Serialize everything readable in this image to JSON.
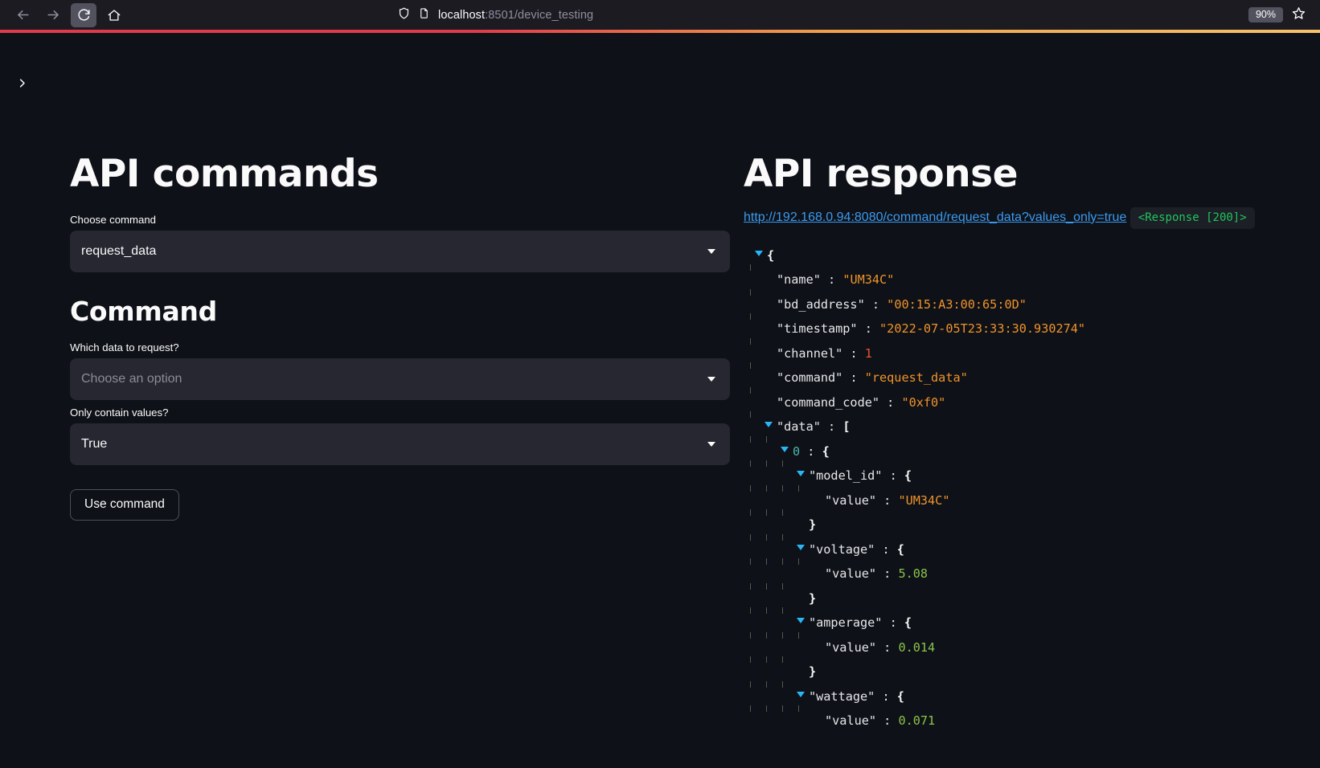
{
  "browser": {
    "back_icon": "arrow-left-icon",
    "forward_icon": "arrow-right-icon",
    "reload_icon": "reload-icon",
    "home_icon": "home-icon",
    "shield_icon": "shield-icon",
    "page_icon": "page-icon",
    "url_prefix": "localhost",
    "url_suffix": ":8501/device_testing",
    "zoom_level": "90%",
    "bookmark_icon": "star-icon"
  },
  "sidebar": {
    "expand_icon": "chevron-right-icon"
  },
  "left": {
    "title": "API commands",
    "choose_command_label": "Choose command",
    "choose_command_value": "request_data",
    "command_title": "Command",
    "which_data_label": "Which data to request?",
    "which_data_value": "Choose an option",
    "only_values_label": "Only contain values?",
    "only_values_value": "True",
    "use_command_button": "Use command"
  },
  "right": {
    "title": "API response",
    "request_url": "http://192.168.0.94:8080/command/request_data?values_only=true",
    "response_status": "<Response [200]>"
  },
  "json": {
    "open_brace": "{",
    "close_brace": "}",
    "open_bracket": "[",
    "colon": ":",
    "rows": {
      "name_key": "\"name\"",
      "name_val": "\"UM34C\"",
      "bd_address_key": "\"bd_address\"",
      "bd_address_val": "\"00:15:A3:00:65:0D\"",
      "timestamp_key": "\"timestamp\"",
      "timestamp_val": "\"2022-07-05T23:33:30.930274\"",
      "channel_key": "\"channel\"",
      "channel_val": "1",
      "command_key": "\"command\"",
      "command_val": "\"request_data\"",
      "command_code_key": "\"command_code\"",
      "command_code_val": "\"0xf0\"",
      "data_key": "\"data\"",
      "index_0": "0",
      "model_id_key": "\"model_id\"",
      "value_key": "\"value\"",
      "model_id_val": "\"UM34C\"",
      "voltage_key": "\"voltage\"",
      "voltage_val": "5.08",
      "amperage_key": "\"amperage\"",
      "amperage_val": "0.014",
      "wattage_key": "\"wattage\"",
      "wattage_val": "0.071"
    }
  }
}
